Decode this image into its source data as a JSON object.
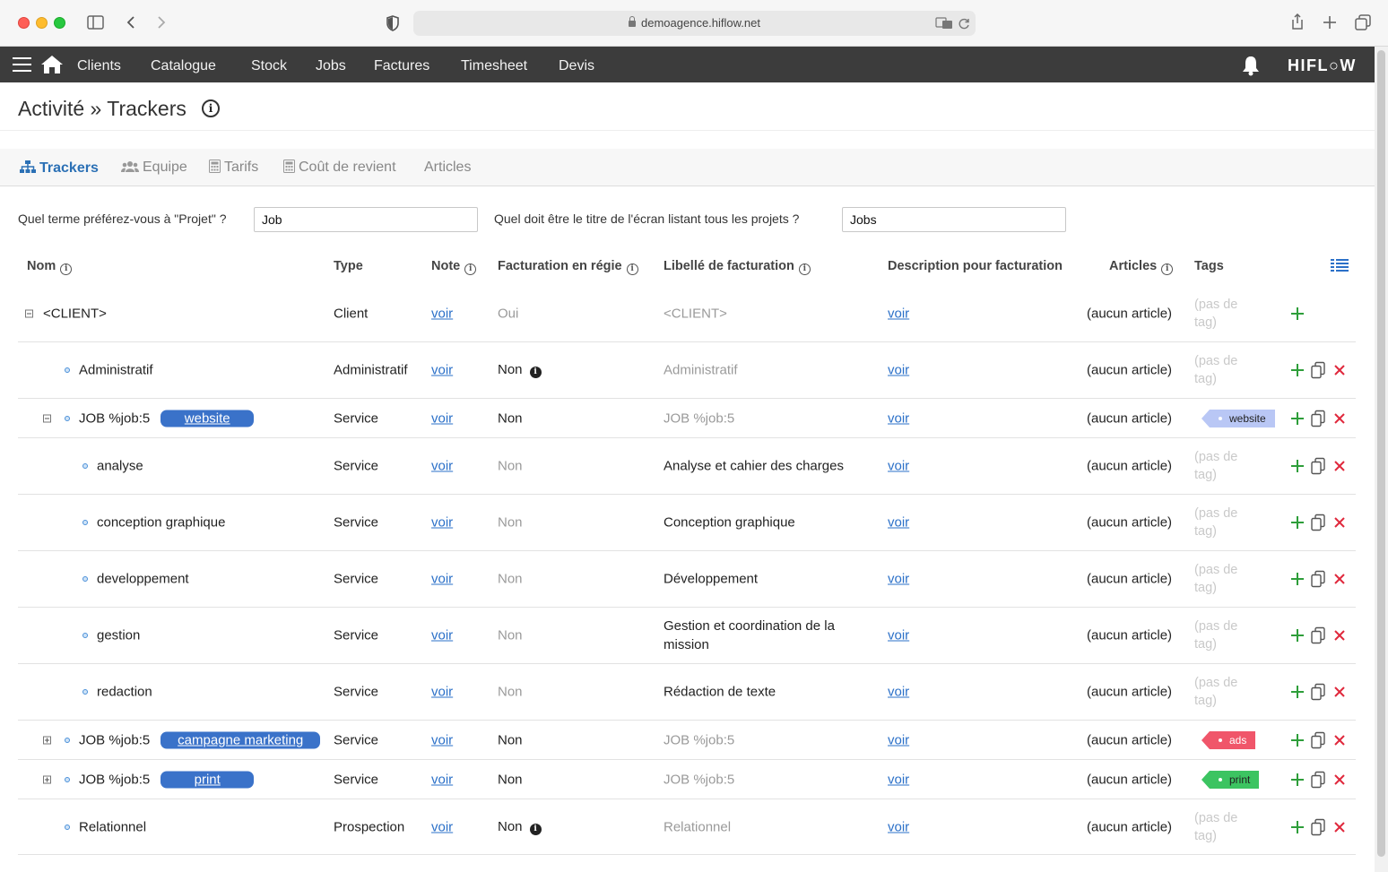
{
  "browser": {
    "url": "demoagence.hiflow.net"
  },
  "nav": {
    "items": [
      "Clients",
      "Catalogue",
      "Stock",
      "Jobs",
      "Factures",
      "Timesheet",
      "Devis"
    ],
    "logo": "HIFL○W"
  },
  "page": {
    "title": "Activité » Trackers"
  },
  "tabs": [
    {
      "label": "Trackers",
      "active": true,
      "icon": "sitemap-icon"
    },
    {
      "label": "Equipe",
      "active": false,
      "icon": "users-icon"
    },
    {
      "label": "Tarifs",
      "active": false,
      "icon": "calculator-icon"
    },
    {
      "label": "Coût de revient",
      "active": false,
      "icon": "calculator-icon"
    },
    {
      "label": "Articles",
      "active": false,
      "icon": ""
    }
  ],
  "settings": {
    "project_term_label": "Quel terme préférez-vous à \"Projet\" ?",
    "project_term_value": "Job",
    "screen_title_label": "Quel doit être le titre de l'écran listant tous les projets ?",
    "screen_title_value": "Jobs"
  },
  "table": {
    "headers": {
      "nom": "Nom",
      "type": "Type",
      "note": "Note",
      "facturation": "Facturation en régie",
      "libelle": "Libellé de facturation",
      "description": "Description pour facturation",
      "articles": "Articles",
      "tags": "Tags"
    },
    "no_tag": "(pas de tag)",
    "rows": [
      {
        "name": "<CLIENT>",
        "type": "Client",
        "note": "voir",
        "regie": "Oui",
        "regie_muted": true,
        "regie_info": false,
        "libelle": "<CLIENT>",
        "libelle_muted": true,
        "description": "voir",
        "articles": "(aucun article)",
        "tag": null
      },
      {
        "name": "Administratif",
        "type": "Administratif",
        "note": "voir",
        "regie": "Non",
        "regie_muted": false,
        "regie_info": true,
        "libelle": "Administratif",
        "libelle_muted": true,
        "description": "voir",
        "articles": "(aucun article)",
        "tag": null
      },
      {
        "name": "JOB %job:5",
        "badge": "website",
        "type": "Service",
        "note": "voir",
        "regie": "Non",
        "regie_muted": false,
        "regie_info": false,
        "libelle": "JOB %job:5",
        "libelle_muted": true,
        "description": "voir",
        "articles": "(aucun article)",
        "tag": "website"
      },
      {
        "name": "analyse",
        "type": "Service",
        "note": "voir",
        "regie": "Non",
        "regie_muted": true,
        "regie_info": false,
        "libelle": "Analyse et cahier des charges",
        "libelle_muted": false,
        "description": "voir",
        "articles": "(aucun article)",
        "tag": null
      },
      {
        "name": "conception graphique",
        "type": "Service",
        "note": "voir",
        "regie": "Non",
        "regie_muted": true,
        "regie_info": false,
        "libelle": "Conception graphique",
        "libelle_muted": false,
        "description": "voir",
        "articles": "(aucun article)",
        "tag": null
      },
      {
        "name": "developpement",
        "type": "Service",
        "note": "voir",
        "regie": "Non",
        "regie_muted": true,
        "regie_info": false,
        "libelle": "Développement",
        "libelle_muted": false,
        "description": "voir",
        "articles": "(aucun article)",
        "tag": null
      },
      {
        "name": "gestion",
        "type": "Service",
        "note": "voir",
        "regie": "Non",
        "regie_muted": true,
        "regie_info": false,
        "libelle": "Gestion et coordination de la mission",
        "libelle_muted": false,
        "description": "voir",
        "articles": "(aucun article)",
        "tag": null
      },
      {
        "name": "redaction",
        "type": "Service",
        "note": "voir",
        "regie": "Non",
        "regie_muted": true,
        "regie_info": false,
        "libelle": "Rédaction de texte",
        "libelle_muted": false,
        "description": "voir",
        "articles": "(aucun article)",
        "tag": null
      },
      {
        "name": "JOB %job:5",
        "badge": "campagne marketing",
        "type": "Service",
        "note": "voir",
        "regie": "Non",
        "regie_muted": false,
        "regie_info": false,
        "libelle": "JOB %job:5",
        "libelle_muted": true,
        "description": "voir",
        "articles": "(aucun article)",
        "tag": "ads"
      },
      {
        "name": "JOB %job:5",
        "badge": "print",
        "type": "Service",
        "note": "voir",
        "regie": "Non",
        "regie_muted": false,
        "regie_info": false,
        "libelle": "JOB %job:5",
        "libelle_muted": true,
        "description": "voir",
        "articles": "(aucun article)",
        "tag": "print"
      },
      {
        "name": "Relationnel",
        "type": "Prospection",
        "note": "voir",
        "regie": "Non",
        "regie_muted": false,
        "regie_info": true,
        "libelle": "Relationnel",
        "libelle_muted": true,
        "description": "voir",
        "articles": "(aucun article)",
        "tag": null
      }
    ]
  },
  "colors": {
    "nav_bg": "#3c3c3c",
    "accent": "#2b70b5",
    "badge": "#3a72c9",
    "tag_website": "#b9c7f5",
    "tag_ads": "#f0566a",
    "tag_print": "#3cc461",
    "action_add": "#2e9e3a",
    "action_delete": "#e0293d"
  }
}
